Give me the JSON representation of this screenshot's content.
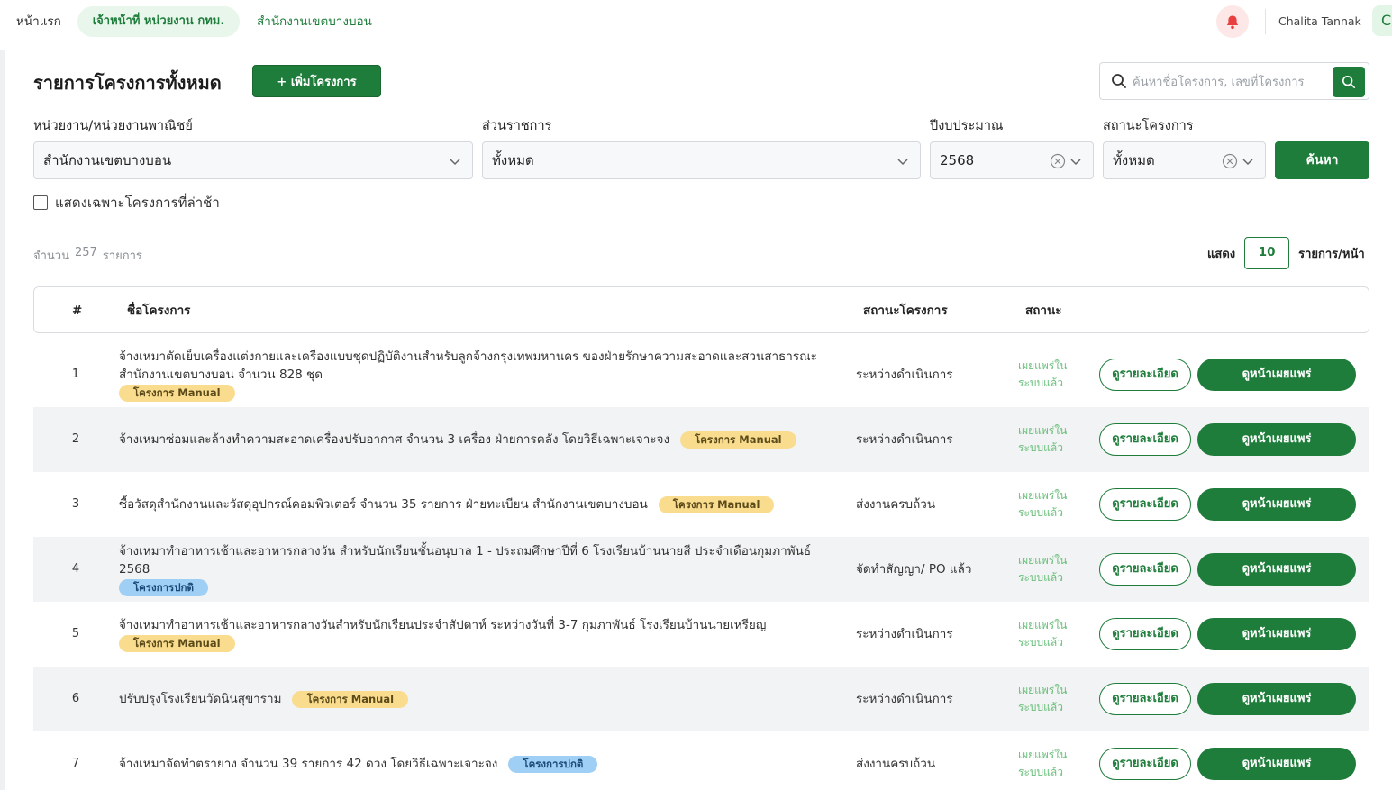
{
  "nav": {
    "home": "หน้าแรก",
    "role": "เจ้าหน้าที่ หน่วยงาน กทม.",
    "office": "สำนักงานเขตบางบอน",
    "user_name": "Chalita Tannak",
    "avatar_initial": "C"
  },
  "header": {
    "title": "รายการโครงการทั้งหมด",
    "add_label": "+ เพิ่มโครงการ",
    "search_placeholder": "ค้นหาชื่อโครงการ, เลขที่โครงการ"
  },
  "filters": {
    "agency": {
      "label": "หน่วยงาน/หน่วยงานพาณิชย์",
      "value": "สำนักงานเขตบางบอน"
    },
    "division": {
      "label": "ส่วนราชการ",
      "value": "ทั้งหมด"
    },
    "budget_year": {
      "label": "ปีงบประมาณ",
      "value": "2568"
    },
    "project_status": {
      "label": "สถานะโครงการ",
      "value": "ทั้งหมด"
    },
    "search_button": "ค้นหา",
    "late_only_label": "แสดงเฉพาะโครงการที่ล่าช้า",
    "late_only_checked": false
  },
  "summary": {
    "count_prefix": "จำนวน",
    "count": "257",
    "count_suffix": "รายการ",
    "show_label": "แสดง",
    "page_size": "10",
    "per_page_label": "รายการ/หน้า"
  },
  "table": {
    "columns": {
      "num": "#",
      "name": "ชื่อโครงการ",
      "project_status": "สถานะโครงการ",
      "status": "สถานะ"
    },
    "detail_label": "ดูรายละเอียด",
    "publish_page_label": "ดูหน้าเผยแพร่",
    "rows": [
      {
        "num": "1",
        "name": "จ้างเหมาตัดเย็บเครื่องแต่งกายและเครื่องแบบชุดปฏิบัติงานสำหรับลูกจ้างกรุงเทพมหานคร ของฝ่ายรักษาความสะอาดและสวนสาธารณะ สำนักงานเขตบางบอน จำนวน 828 ชุด",
        "tag": "โครงการ Manual",
        "tag_type": "manual",
        "project_status": "ระหว่างดำเนินการ",
        "status": "เผยแพร่ใน ระบบแล้ว"
      },
      {
        "num": "2",
        "name": "จ้างเหมาซ่อมและล้างทำความสะอาดเครื่องปรับอากาศ จำนวน 3 เครื่อง ฝ่ายการคลัง โดยวิธีเฉพาะเจาะจง",
        "tag": "โครงการ Manual",
        "tag_type": "manual",
        "project_status": "ระหว่างดำเนินการ",
        "status": "เผยแพร่ใน ระบบแล้ว"
      },
      {
        "num": "3",
        "name": "ซื้อวัสดุสำนักงานและวัสดุอุปกรณ์คอมพิวเตอร์ จำนวน 35 รายการ ฝ่ายทะเบียน สำนักงานเขตบางบอน",
        "tag": "โครงการ Manual",
        "tag_type": "manual",
        "project_status": "ส่งงานครบถ้วน",
        "status": "เผยแพร่ใน ระบบแล้ว"
      },
      {
        "num": "4",
        "name": "จ้างเหมาทำอาหารเช้าและอาหารกลางวัน สำหรับนักเรียนชั้นอนุบาล 1 - ประถมศึกษาปีที่ 6 โรงเรียนบ้านนายสี ประจำเดือนกุมภาพันธ์ 2568",
        "tag": "โครงการปกติ",
        "tag_type": "normal",
        "project_status": "จัดทำสัญญา/ PO แล้ว",
        "status": "เผยแพร่ใน ระบบแล้ว"
      },
      {
        "num": "5",
        "name": "จ้างเหมาทำอาหารเช้าและอาหารกลางวันสำหรับนักเรียนประจำสัปดาห์ ระหว่างวันที่ 3-7 กุมภาพันธ์ โรงเรียนบ้านนายเหรียญ",
        "tag": "โครงการ Manual",
        "tag_type": "manual",
        "project_status": "ระหว่างดำเนินการ",
        "status": "เผยแพร่ใน ระบบแล้ว"
      },
      {
        "num": "6",
        "name": "ปรับปรุงโรงเรียนวัดนินสุขาราม",
        "tag": "โครงการ Manual",
        "tag_type": "manual",
        "project_status": "ระหว่างดำเนินการ",
        "status": "เผยแพร่ใน ระบบแล้ว"
      },
      {
        "num": "7",
        "name": "จ้างเหมาจัดทำตรายาง จำนวน 39 รายการ 42 ดวง โดยวิธีเฉพาะเจาะจง",
        "tag": "โครงการปกติ",
        "tag_type": "normal",
        "project_status": "ส่งงานครบถ้วน",
        "status": "เผยแพร่ใน ระบบแล้ว"
      }
    ]
  },
  "colors": {
    "primary": "#1e7d3a",
    "published_text": "#6bbf7c",
    "tag_manual": "#f9dc8e",
    "tag_normal": "#9fcff5"
  }
}
